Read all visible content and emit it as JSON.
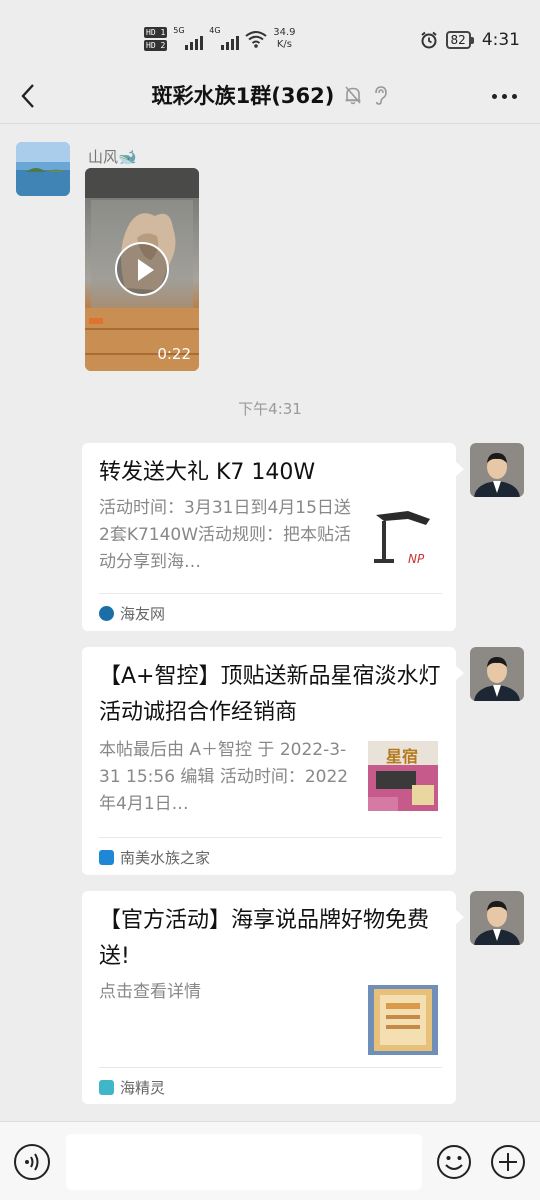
{
  "status_bar": {
    "hd1": "HD 1",
    "hd2": "HD 2",
    "net1": "5G",
    "net2": "4G",
    "speed_value": "34.9",
    "speed_unit": "K/s",
    "battery": "82",
    "time": "4:31"
  },
  "header": {
    "title": "斑彩水族1群(362)"
  },
  "messages": {
    "video": {
      "sender": "山风🐋",
      "duration": "0:22"
    },
    "time_label": "下午4:31",
    "cards": [
      {
        "title": "转发送大礼 K7 140W",
        "desc": "活动时间：3月31日到4月15日送2套K7140W活动规则：把本贴活动分享到海…",
        "source": "海友网",
        "source_color": "#1b6fa8"
      },
      {
        "title": "【A+智控】顶贴送新品星宿淡水灯活动诚招合作经销商",
        "desc": " 本帖最后由 A＋智控 于 2022-3-31 15:56 编辑 活动时间：2022年4月1日…",
        "source": "南美水族之家",
        "source_color": "#1e88d6",
        "thumb_text": "星宿"
      },
      {
        "title": "【官方活动】海享说品牌好物免费送!",
        "desc": "点击查看详情",
        "source": "海精灵",
        "source_color": "#3fb7c9"
      }
    ]
  },
  "input": {
    "placeholder": ""
  }
}
